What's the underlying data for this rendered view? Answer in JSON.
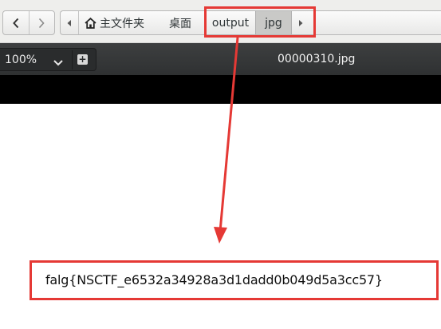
{
  "navigation": {
    "back_icon": "chevron-left-icon",
    "forward_icon": "chevron-right-icon"
  },
  "breadcrumb": {
    "items": [
      {
        "label": "主文件夹",
        "icon": "home-icon"
      },
      {
        "label": "桌面"
      },
      {
        "label": "output"
      },
      {
        "label": "jpg"
      }
    ],
    "active": "jpg"
  },
  "viewer": {
    "zoom": "100%",
    "title": "00000310.jpg"
  },
  "image_content": {
    "flag_text": "falg{NSCTF_e6532a34928a3d1dadd0b049d5a3cc57}"
  },
  "annotation": {
    "color": "#e53935"
  }
}
